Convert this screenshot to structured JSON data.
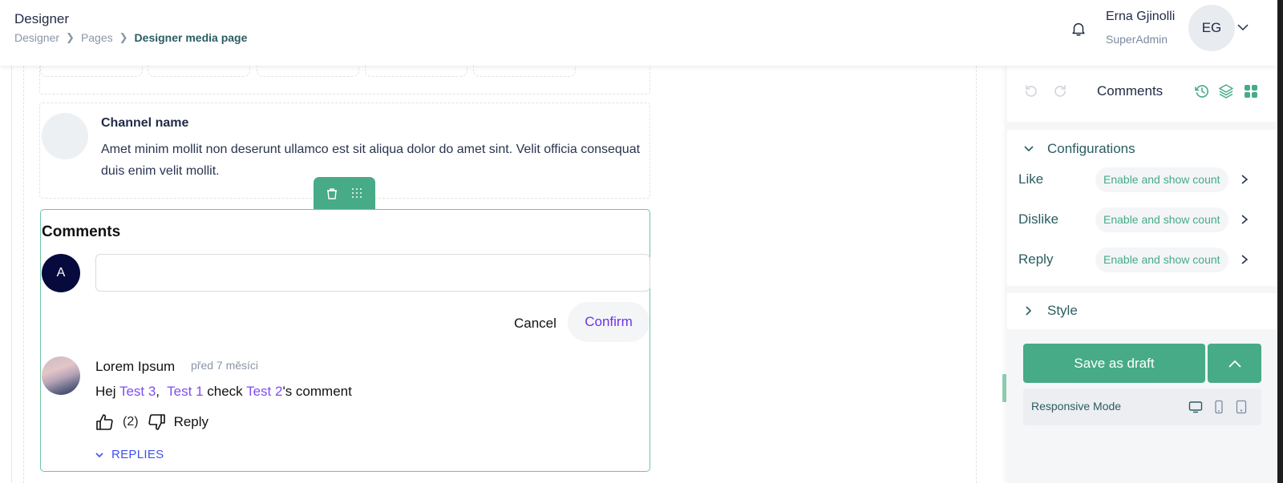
{
  "header": {
    "title": "Designer",
    "breadcrumb": [
      {
        "label": "Designer"
      },
      {
        "label": "Pages"
      },
      {
        "label": "Designer media page"
      }
    ],
    "user": {
      "name": "Erna Gjinolli",
      "role": "SuperAdmin",
      "initials": "EG"
    }
  },
  "canvas": {
    "channel": {
      "name": "Channel name",
      "description": "Amet minim mollit non deserunt ullamco est sit aliqua dolor do amet sint. Velit officia consequat duis enim velit mollit."
    },
    "comments": {
      "title": "Comments",
      "current_user_initial": "A",
      "input_value": "",
      "input_placeholder": "",
      "cancel_label": "Cancel",
      "confirm_label": "Confirm",
      "items": [
        {
          "author": "Lorem Ipsum",
          "time": "před 7 měsíci",
          "body": [
            {
              "text": "Hej ",
              "mention": false
            },
            {
              "text": "Test 3",
              "mention": true
            },
            {
              "text": ",  ",
              "mention": false
            },
            {
              "text": "Test 1",
              "mention": true
            },
            {
              "text": " check ",
              "mention": false
            },
            {
              "text": "Test 2",
              "mention": true
            },
            {
              "text": "'s comment",
              "mention": false
            }
          ],
          "like_count": "(2)",
          "reply_label": "Reply",
          "replies_label": "REPLIES"
        }
      ]
    }
  },
  "panel": {
    "title": "Comments",
    "configurations": {
      "label": "Configurations",
      "rows": [
        {
          "label": "Like",
          "value": "Enable and show count"
        },
        {
          "label": "Dislike",
          "value": "Enable and show count"
        },
        {
          "label": "Reply",
          "value": "Enable and show count"
        }
      ]
    },
    "style_label": "Style",
    "save_label": "Save as draft",
    "responsive_label": "Responsive Mode"
  },
  "colors": {
    "accent": "#47ab87",
    "mention": "#7d4ef0",
    "replies": "#3e4ff0",
    "avatar_dark": "#070a3c"
  }
}
